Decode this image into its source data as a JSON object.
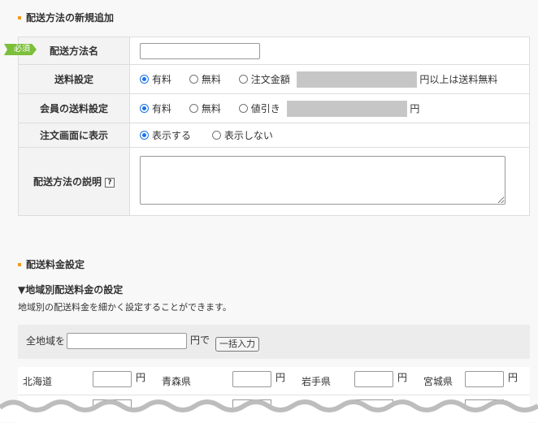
{
  "section1": {
    "title": "配送方法の新規追加"
  },
  "form": {
    "required_badge": "必須",
    "row_name": {
      "label": "配送方法名",
      "value": ""
    },
    "row_shipping": {
      "label": "送料設定",
      "options": [
        "有料",
        "無料",
        "注文金額"
      ],
      "suffix": "円以上は送料無料"
    },
    "row_member": {
      "label": "会員の送料設定",
      "options": [
        "有料",
        "無料",
        "値引き"
      ],
      "suffix": "円"
    },
    "row_display": {
      "label": "注文画面に表示",
      "options": [
        "表示する",
        "表示しない"
      ]
    },
    "row_desc": {
      "label": "配送方法の説明",
      "help": "?"
    }
  },
  "section2": {
    "title": "配送料金設定"
  },
  "regional": {
    "heading": "▼地域別配送料金の設定",
    "description": "地域別の配送料金を細かく設定することができます。",
    "bulk_label": "全地域を",
    "bulk_unit": "円で",
    "bulk_button": "一括入力",
    "unit": "円",
    "prefectures": [
      "北海道",
      "青森県",
      "岩手県",
      "宮城県"
    ]
  }
}
